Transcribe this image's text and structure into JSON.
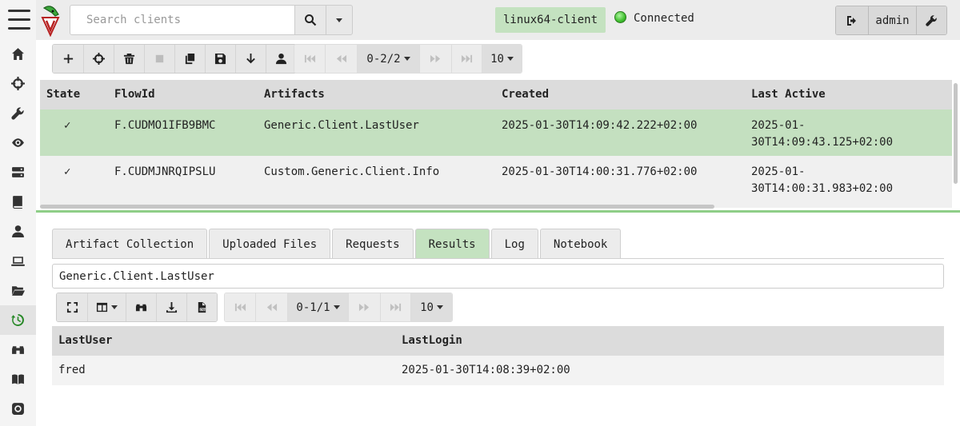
{
  "search": {
    "placeholder": "Search clients"
  },
  "client": {
    "name": "linux64-client",
    "status": "Connected",
    "status_color": "#3fbf2e"
  },
  "user": {
    "name": "admin"
  },
  "flow_pager": {
    "range": "0-2/2",
    "page_size": "10"
  },
  "flows": {
    "columns": [
      "State",
      "FlowId",
      "Artifacts",
      "Created",
      "Last Active"
    ],
    "rows": [
      {
        "state": "✓",
        "flow_id": "F.CUDMO1IFB9BMC",
        "artifacts": "Generic.Client.LastUser",
        "created": "2025-01-30T14:09:42.222+02:00",
        "last_active_1": "2025-01-",
        "last_active_2": "30T14:09:43.125+02:00"
      },
      {
        "state": "✓",
        "flow_id": "F.CUDMJNRQIPSLU",
        "artifacts": "Custom.Generic.Client.Info",
        "created": "2025-01-30T14:00:31.776+02:00",
        "last_active_1": "2025-01-",
        "last_active_2": "30T14:00:31.983+02:00"
      }
    ]
  },
  "tabs": [
    "Artifact Collection",
    "Uploaded Files",
    "Requests",
    "Results",
    "Log",
    "Notebook"
  ],
  "artifact_select": {
    "value": "Generic.Client.LastUser"
  },
  "result_pager": {
    "range": "0-1/1",
    "page_size": "10"
  },
  "results": {
    "columns": [
      "LastUser",
      "LastLogin"
    ],
    "rows": [
      {
        "last_user": "fred",
        "last_login": "2025-01-30T14:08:39+02:00"
      }
    ]
  },
  "colors": {
    "accent_green": "#c4e2c0",
    "selected_row": "#c4e0c0",
    "divider": "#8fce88"
  }
}
